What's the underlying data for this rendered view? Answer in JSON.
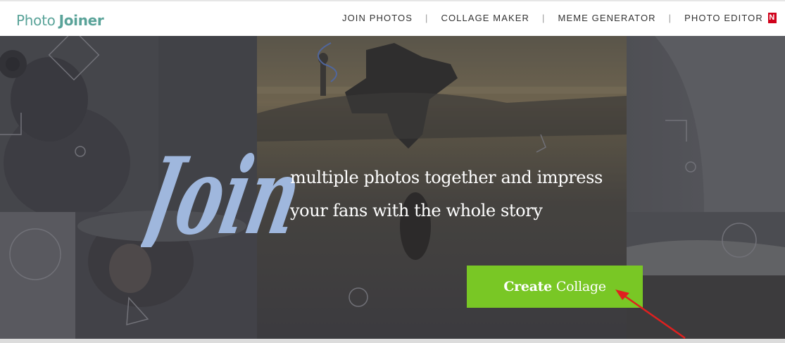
{
  "header": {
    "logo": {
      "part1": "Photo",
      "part2": "Joiner"
    },
    "nav": [
      {
        "label": "JOIN PHOTOS"
      },
      {
        "label": "COLLAGE MAKER"
      },
      {
        "label": "MEME GENERATOR"
      },
      {
        "label": "PHOTO EDITOR"
      }
    ],
    "new_badge": "N"
  },
  "hero": {
    "headline": "Join",
    "tagline_line1": "multiple photos together and impress",
    "tagline_line2": "your fans with the whole story",
    "cta": {
      "bold": "Create",
      "regular": "Collage"
    }
  },
  "colors": {
    "brand_teal": "#5aa399",
    "cta_green": "#79c725",
    "headline_blue": "#9fb7dd",
    "annotation_red": "#e0201f"
  }
}
